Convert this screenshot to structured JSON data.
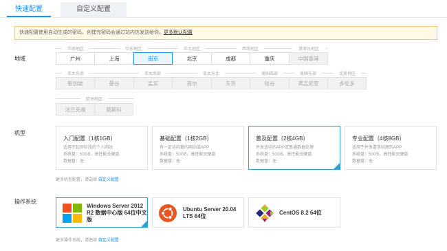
{
  "tabs": {
    "quick": "快速配置",
    "custom": "自定义配置"
  },
  "notice": {
    "text": "快速配置使用自动生成的密码，创建完密码会通过站内信发送给你。",
    "link": "更多默认配置"
  },
  "region": {
    "label": "地域",
    "row1": {
      "groups": [
        "华南地区",
        "华东地区",
        "华北地区",
        "西南地区",
        "港澳台地区"
      ],
      "cells": [
        "广州",
        "上海",
        "南京",
        "北京",
        "成都",
        "重庆",
        "中国香港"
      ]
    },
    "row2": {
      "groups": [
        "亚太东南",
        "亚太南部",
        "亚太东北",
        "美国西部",
        "美国东部",
        "北美地区"
      ],
      "cells": [
        "新加坡",
        "曼谷",
        "孟买",
        "首尔",
        "东京",
        "硅谷",
        "弗吉尼亚",
        "多伦多"
      ]
    },
    "row3": {
      "groups": [
        "欧洲地区"
      ],
      "cells": [
        "法兰克福",
        "莫斯科"
      ]
    }
  },
  "spec": {
    "label": "机型",
    "cards": [
      {
        "title": "入门配置（1核1GB）",
        "desc": "适用于起步阶段的个人网站",
        "disk": "系统盘：50GB，高性能云硬盘",
        "data": "数据盘：无"
      },
      {
        "title": "基础配置（1核2GB）",
        "desc": "有一定访问量的网站或APP",
        "disk": "系统盘：50GB，高性能云硬盘",
        "data": "数据盘：无"
      },
      {
        "title": "普及配置（2核4GB）",
        "desc": "并发适中的APP或普通数据处理",
        "disk": "系统盘：50GB，高性能云硬盘",
        "data": "数据盘：无"
      },
      {
        "title": "专业配置（4核8GB）",
        "desc": "适用于并发要求较高的APP",
        "disk": "系统盘：50GB，高性能云硬盘",
        "data": "数据盘：无"
      }
    ],
    "more_text": "更多机型配置，请选择",
    "more_link": "自定义配置"
  },
  "os": {
    "label": "操作系统",
    "cards": [
      {
        "name_line1": "Windows Server 2012",
        "name_line2": "R2 数据中心版 64位中文",
        "name_line3": "版",
        "icon": "windows-logo"
      },
      {
        "name_line1": "Ubuntu Server 20.04",
        "name_line2": "LTS 64位",
        "icon": "ubuntu-logo"
      },
      {
        "name_line1": "CentOS 8.2 64位",
        "icon": "centos-logo"
      }
    ],
    "more_text": "更多操作系统，请选择",
    "more_link": "自定义配置"
  },
  "colors": {
    "accent": "#1890ff",
    "selected_border": "#2aa1d8",
    "notice_bg": "#fff9e6",
    "notice_border": "#f5c86a"
  }
}
